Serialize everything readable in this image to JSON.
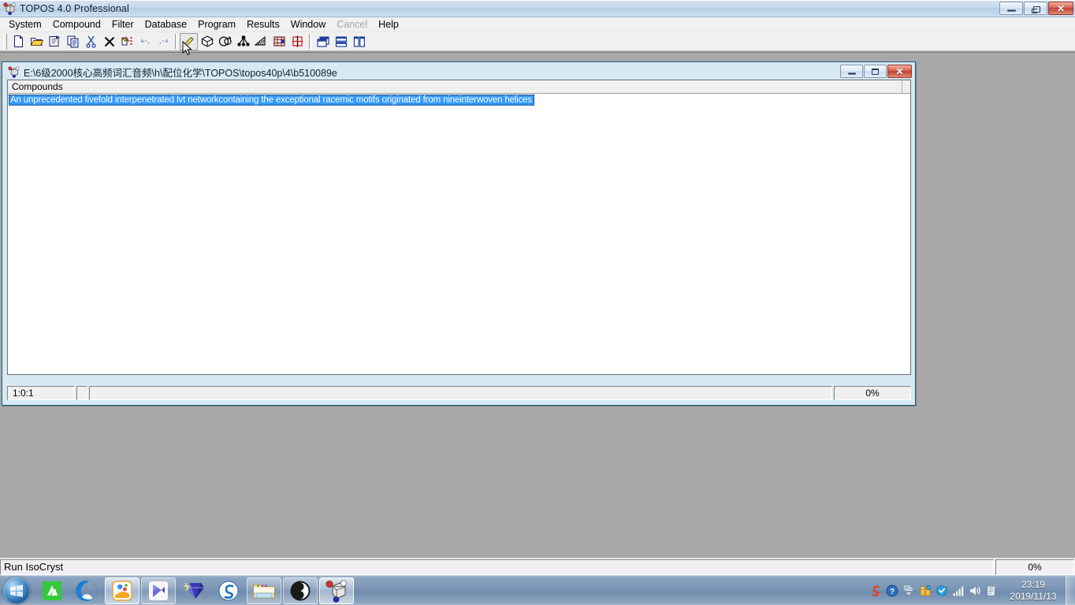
{
  "window": {
    "title": "TOPOS 4.0 Professional",
    "icon": "topos-logo-icon",
    "buttons": {
      "minimize": "Minimize",
      "restore": "Restore",
      "close": "Close"
    }
  },
  "menubar": {
    "items": [
      {
        "label": "System",
        "disabled": false
      },
      {
        "label": "Compound",
        "disabled": false
      },
      {
        "label": "Filter",
        "disabled": false
      },
      {
        "label": "Database",
        "disabled": false
      },
      {
        "label": "Program",
        "disabled": false
      },
      {
        "label": "Results",
        "disabled": false
      },
      {
        "label": "Window",
        "disabled": false
      },
      {
        "label": "Cancel",
        "disabled": true
      },
      {
        "label": "Help",
        "disabled": false
      }
    ]
  },
  "toolbar": {
    "buttons": [
      {
        "name": "new-file-icon",
        "disabled": false
      },
      {
        "name": "open-folder-icon",
        "disabled": false
      },
      {
        "name": "properties-icon",
        "disabled": false
      },
      {
        "name": "copy-icon",
        "disabled": false
      },
      {
        "name": "cut-scissors-icon",
        "disabled": false
      },
      {
        "name": "delete-x-icon",
        "disabled": false
      },
      {
        "name": "paste-icon",
        "disabled": false
      },
      {
        "name": "undo-icon",
        "disabled": true
      },
      {
        "name": "redo-icon",
        "disabled": true
      },
      {
        "name": "pencil-adjacency-icon",
        "disabled": false
      },
      {
        "name": "polyhedron-icon",
        "disabled": false
      },
      {
        "name": "dirichlet-icon",
        "disabled": false
      },
      {
        "name": "net-topology-icon",
        "disabled": false
      },
      {
        "name": "ada-icon",
        "disabled": false
      },
      {
        "name": "isocryst-icon",
        "disabled": false
      },
      {
        "name": "hsite-icon",
        "disabled": false
      },
      {
        "name": "cascade-windows-icon",
        "disabled": false
      },
      {
        "name": "tile-horizontal-icon",
        "disabled": false
      },
      {
        "name": "tile-vertical-icon",
        "disabled": false
      }
    ]
  },
  "child_window": {
    "title": "E:\\6级2000核心高频词汇音频\\h\\配位化学\\TOPOS\\topos40p\\4\\b510089e",
    "icon": "topos-document-icon",
    "list": {
      "columns": [
        "Compounds"
      ],
      "rows": [
        {
          "text": "An unprecedented fivefold interpenetrated lvt networkcontaining the exceptional racemic motifs originated from nineinterwoven helices",
          "selected": true
        }
      ]
    },
    "status": {
      "coords": "1:0:1",
      "flag": "",
      "message": "",
      "progress": "0%"
    }
  },
  "main_status": {
    "message": "Run IsoCryst",
    "progress": "0%"
  },
  "taskbar": {
    "start": "start-orb",
    "items": [
      {
        "name": "taskbar-item-greenshot",
        "framed": false,
        "active": false
      },
      {
        "name": "taskbar-item-browser",
        "framed": false,
        "active": false
      },
      {
        "name": "taskbar-item-kingsoft",
        "framed": true,
        "active": true
      },
      {
        "name": "taskbar-item-foxmail",
        "framed": true,
        "active": false
      },
      {
        "name": "taskbar-item-diamond",
        "framed": false,
        "active": false
      },
      {
        "name": "taskbar-item-sogou-input",
        "framed": false,
        "active": false
      },
      {
        "name": "taskbar-item-explorer",
        "framed": true,
        "active": false
      },
      {
        "name": "taskbar-item-obs",
        "framed": true,
        "active": false
      },
      {
        "name": "taskbar-item-topos",
        "framed": true,
        "active": true
      }
    ],
    "tray": {
      "icons": [
        {
          "name": "sogou-tray-icon"
        },
        {
          "name": "help-tray-icon"
        },
        {
          "name": "show-hidden-icons-icon"
        },
        {
          "name": "package-tray-icon"
        },
        {
          "name": "security-shield-tray-icon"
        },
        {
          "name": "network-signal-icon"
        },
        {
          "name": "volume-speaker-icon"
        },
        {
          "name": "clipboard-tray-icon"
        }
      ],
      "clock": {
        "time": "23:19",
        "date": "2019/11/13"
      }
    }
  },
  "colors": {
    "selection_blue": "#3399ff",
    "desktop_gray": "#a8a8a8",
    "child_frame": "#d6e9f5",
    "child_border": "#1b6277",
    "close_red": "#c2442f"
  }
}
